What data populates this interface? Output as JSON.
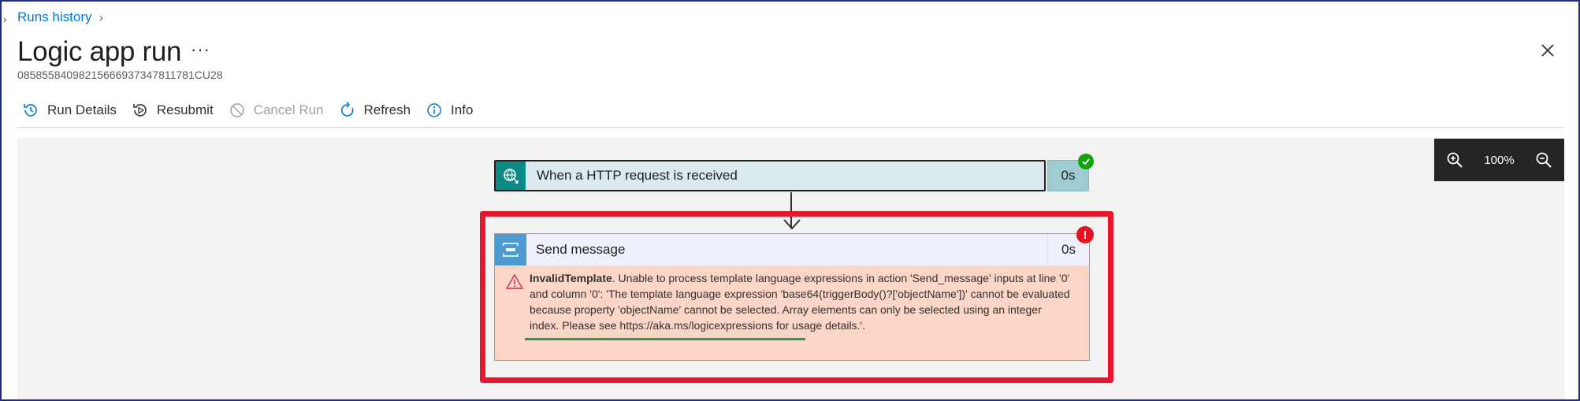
{
  "breadcrumb": {
    "items": [
      "Runs history"
    ]
  },
  "header": {
    "title": "Logic app run",
    "more": "···",
    "run_id": "08585584098215666937347811781CU28"
  },
  "toolbar": {
    "run_details": "Run Details",
    "resubmit": "Resubmit",
    "cancel_run": "Cancel Run",
    "refresh": "Refresh",
    "info": "Info"
  },
  "zoom": {
    "level": "100%"
  },
  "trigger": {
    "name": "When a HTTP request is received",
    "duration": "0s",
    "status": "succeeded"
  },
  "action": {
    "name": "Send message",
    "duration": "0s",
    "status": "failed",
    "error_code": "InvalidTemplate",
    "error_message": ". Unable to process template language expressions in action 'Send_message' inputs at line '0' and column '0': 'The template language expression 'base64(triggerBody()?['objectName'])' cannot be evaluated because property 'objectName' cannot be selected. Array elements can only be selected using an integer index. Please see https://aka.ms/logicexpressions for usage details.'."
  },
  "colors": {
    "accent": "#0078d4",
    "trigger_icon_bg": "#0e8a86",
    "action_icon_bg": "#4b9bd1",
    "error_bg": "#fbd5c6",
    "highlight": "#e8162f",
    "success": "#13a10e",
    "underline": "#1fa34a"
  }
}
